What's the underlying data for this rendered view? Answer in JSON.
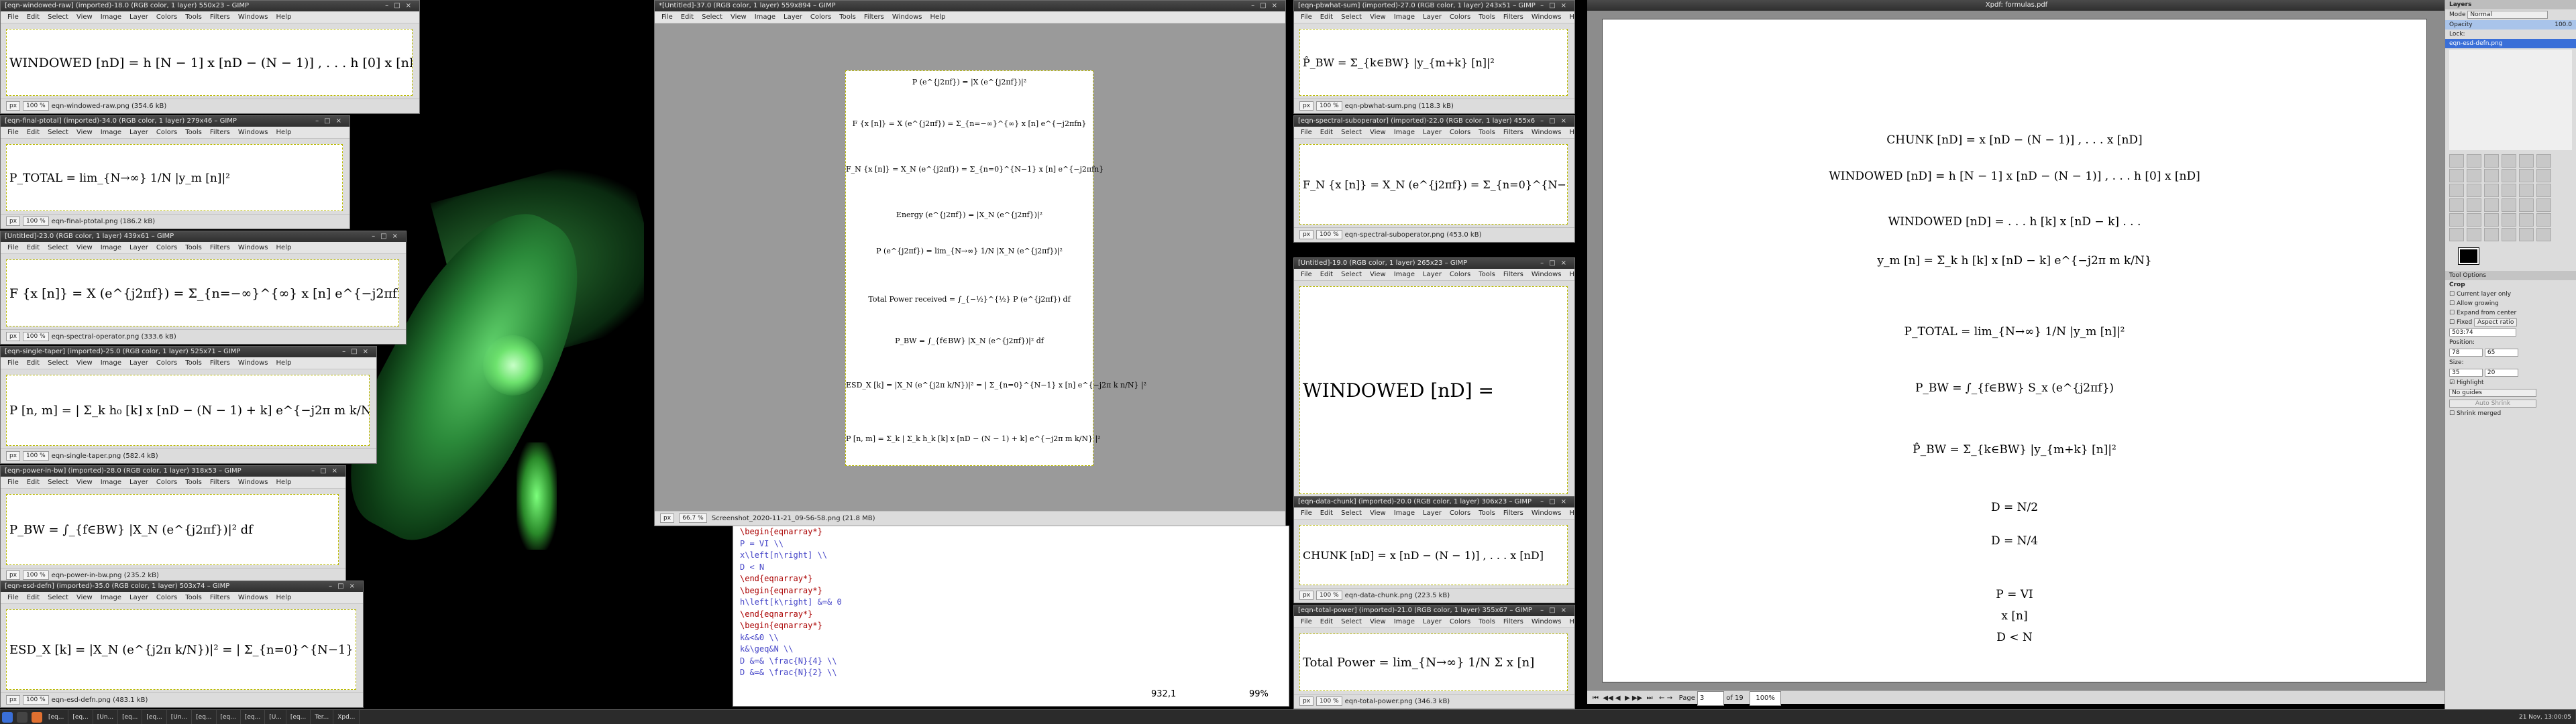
{
  "menu": [
    "File",
    "Edit",
    "Select",
    "View",
    "Image",
    "Layer",
    "Colors",
    "Tools",
    "Filters",
    "Windows",
    "Help"
  ],
  "gimp_windows": [
    {
      "title": "[eqn-windowed-raw] (imported)-18.0 (RGB color, 1 layer) 550x23 – GIMP",
      "zoom": "100 %",
      "unit": "px",
      "status": "eqn-windowed-raw.png (354.6 kB)",
      "formula": "WINDOWED [nD]   =   h [N − 1] x [nD − (N − 1)] , . . . h [0] x [nD]"
    },
    {
      "title": "[eqn-final-ptotal] (imported)-34.0 (RGB color, 1 layer) 279x46 – GIMP",
      "zoom": "100 %",
      "unit": "px",
      "status": "eqn-final-ptotal.png (186.2 kB)",
      "formula": "P_TOTAL  =  lim_{N→∞} 1/N |y_m [n]|²"
    },
    {
      "title": "[Untitled]-23.0 (RGB color, 1 layer) 439x61 – GIMP",
      "zoom": "100 %",
      "unit": "px",
      "status": "eqn-spectral-operator.png (333.6 kB)",
      "formula": "F {x [n]}  =  X (e^{j2πf})  =  Σ_{n=−∞}^{∞} x [n] e^{−j2πfn}"
    },
    {
      "title": "[eqn-single-taper] (imported)-25.0 (RGB color, 1 layer) 525x71 – GIMP",
      "zoom": "100 %",
      "unit": "px",
      "status": "eqn-single-taper.png (582.4 kB)",
      "formula": "P [n, m]  =  | Σ_k h₀ [k] x [nD − (N − 1) + k] e^{−j2π m k/N} |²"
    },
    {
      "title": "[eqn-power-in-bw] (imported)-28.0 (RGB color, 1 layer) 318x53 – GIMP",
      "zoom": "100 %",
      "unit": "px",
      "status": "eqn-power-in-bw.png (235.2 kB)",
      "formula": "P_BW  =  ∫_{f∈BW} |X_N (e^{j2πf})|² df"
    },
    {
      "title": "[eqn-esd-defn] (imported)-35.0 (RGB color, 1 layer) 503x74 – GIMP",
      "zoom": "100 %",
      "unit": "px",
      "status": "eqn-esd-defn.png (483.1 kB)",
      "formula": "ESD_X [k]  =  |X_N (e^{j2π k/N})|²  =  | Σ_{n=0}^{N−1} x [n] e^{−j2π k n/N} |²"
    }
  ],
  "center_window": {
    "title": "*[Untitled]-37.0 (RGB color, 1 layer) 559x894 – GIMP",
    "zoom": "66.7 %",
    "unit": "px",
    "status": "Screenshot_2020-11-21_09-56-58.png (21.8 MB)",
    "equations": [
      "P (e^{j2πf})  =  |X (e^{j2πf})|²",
      "F {x [n]}  =  X (e^{j2πf})  =  Σ_{n=−∞}^{∞} x [n] e^{−j2πfn}",
      "F_N {x [n]}  =  X_N (e^{j2πf})  =  Σ_{n=0}^{N−1} x [n] e^{−j2πfn}",
      "Energy (e^{j2πf})  =  |X_N (e^{j2πf})|²",
      "P (e^{j2πf})  =  lim_{N→∞} 1/N |X_N (e^{j2πf})|²",
      "Total Power received  =  ∫_{−½}^{½} P (e^{j2πf}) df",
      "P_BW  =  ∫_{f∈BW} |X_N (e^{j2πf})|² df",
      "ESD_X [k]  =  |X_N (e^{j2π k/N})|²  =  | Σ_{n=0}^{N−1} x [n] e^{−j2π k n/N} |²",
      "P [n, m]  =  Σ_k | Σ_k h_k [k] x [nD − (N − 1) + k] e^{−j2π m k/N} |²"
    ]
  },
  "editor": {
    "lines": [
      {
        "kw": "\\begin",
        "rest": "{eqnarray*}"
      },
      {
        "kw": "",
        "rest": "P = VI \\\\"
      },
      {
        "kw": "",
        "rest": "x\\left[n\\right] \\\\"
      },
      {
        "kw": "",
        "rest": "D < N"
      },
      {
        "kw": "\\end",
        "rest": "{eqnarray*}"
      },
      {
        "kw": "\\begin",
        "rest": "{eqnarray*}"
      },
      {
        "kw": "",
        "rest": "h\\left[k\\right] &=& 0"
      },
      {
        "kw": "\\end",
        "rest": "{eqnarray*}"
      },
      {
        "kw": "\\begin",
        "rest": "{eqnarray*}"
      },
      {
        "kw": "",
        "rest": "k&<&0 \\\\"
      },
      {
        "kw": "",
        "rest": "k&\\geq&N \\\\"
      },
      {
        "kw": "",
        "rest": "D &=& \\frac{N}{4} \\\\"
      },
      {
        "kw": "",
        "rest": "D &=& \\frac{N}{2} \\\\"
      }
    ],
    "position": "932,1",
    "percent": "99%"
  },
  "right_windows": [
    {
      "title": "[eqn-pbwhat-sum] (imported)-27.0 (RGB color, 1 layer) 243x51 – GIMP",
      "zoom": "100 %",
      "status": "eqn-pbwhat-sum.png (118.3 kB)",
      "formula": "P̂_BW  =  Σ_{k∈BW} |y_{m+k} [n]|²"
    },
    {
      "title": "[eqn-spectral-suboperator] (imported)-22.0 (RGB color, 1 layer) 455x6",
      "zoom": "100 %",
      "status": "eqn-spectral-suboperator.png (453.0 kB)",
      "formula": "F_N {x [n]}  =  X_N (e^{j2πf})  =  Σ_{n=0}^{N−1} x [n] e"
    },
    {
      "title": "[Untitled]-19.0 (RGB color, 1 layer) 265x23 – GIMP",
      "zoom": "200 %",
      "status": "eqn-windowed-data.png (169.5 kB)",
      "formula": "WINDOWED [nD]   ="
    },
    {
      "title": "[eqn-data-chunk] (imported)-20.0 (RGB color, 1 layer) 306x23 – GIMP",
      "zoom": "100 %",
      "status": "eqn-data-chunk.png (223.5 kB)",
      "formula": "CHUNK [nD]  =  x [nD − (N − 1)] , . . . x [nD]"
    },
    {
      "title": "[eqn-total-power] (imported)-21.0 (RGB color, 1 layer) 355x67 – GIMP",
      "zoom": "100 %",
      "status": "eqn-total-power.png (346.3 kB)",
      "formula": "Total Power  =  lim_{N→∞} 1/N Σ x [n]"
    }
  ],
  "pdf": {
    "title": "Xpdf: formulas.pdf",
    "equations": [
      "CHUNK [nD]  =  x [nD − (N − 1)] , . . . x [nD]",
      "WINDOWED [nD]  =  h [N − 1] x [nD − (N − 1)] , . . . h [0] x [nD]",
      "WINDOWED [nD]  =  . . . h [k] x [nD − k] . . .",
      "y_m [n]  =  Σ_k h [k] x [nD − k] e^{−j2π m k/N}",
      "P_TOTAL  =  lim_{N→∞} 1/N |y_m [n]|²",
      "P_BW  =  ∫_{f∈BW} S_x (e^{j2πf})",
      "P̂_BW  =  Σ_{k∈BW} |y_{m+k} [n]|²",
      "D  =  N/2",
      "D  =  N/4",
      "P = VI",
      "x [n]",
      "D < N"
    ],
    "page_label": "Page",
    "page": "3",
    "of_pages": "of 19",
    "zoom": "100%"
  },
  "layers_panel": {
    "title": "Layers",
    "mode_label": "Mode",
    "mode": "Normal",
    "opacity_label": "Opacity",
    "opacity": "100.0",
    "lock_label": "Lock:",
    "layer_name": "eqn-esd-defn.png",
    "tool_options_title": "Tool Options",
    "crop_label": "Crop",
    "options": [
      "Current layer only",
      "Allow growing",
      "Expand from center"
    ],
    "fixed_label": "Fixed",
    "aspect": "Aspect ratio",
    "ratio": "503:74",
    "position_label": "Position:",
    "pos": [
      "78",
      "65"
    ],
    "size_label": "Size:",
    "size": [
      "35",
      "20"
    ],
    "highlight": "Highlight",
    "guides": "No guides",
    "auto_shrink": "Auto Shrink",
    "shrink_merged": "Shrink merged"
  },
  "taskbar": {
    "items": [
      "[eq...",
      "[eq...",
      "[Un...",
      "[eq...",
      "[eq...",
      "[Un...",
      "[eq...",
      "[eq...",
      "[eq...",
      "[U...",
      "[eq...",
      "Ter...",
      "Xpd..."
    ],
    "clock": "21 Nov, 13:00:05"
  },
  "colors": {
    "accent": "#3a6fd8",
    "canvas_border": "#b8b800",
    "glow": "#6ee36e"
  }
}
